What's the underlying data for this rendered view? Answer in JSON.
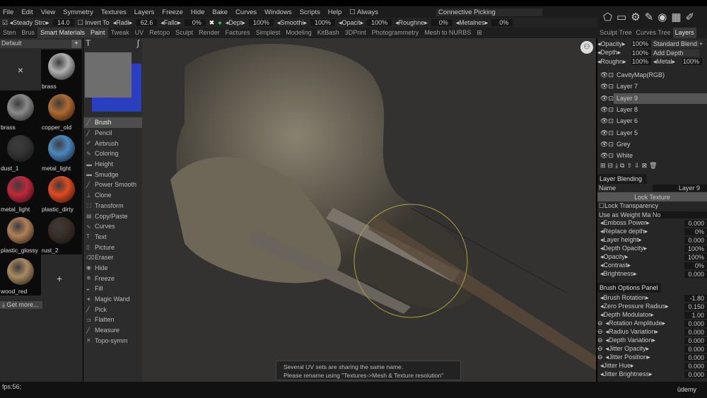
{
  "menu": [
    "File",
    "Edit",
    "View",
    "Symmetry",
    "Textures",
    "Layers",
    "Freeze",
    "Hide",
    "Bake",
    "Curves",
    "Windows",
    "Scripts",
    "Help"
  ],
  "menu_always": "Always",
  "menu_picking": "Connective Picking",
  "toolbar": {
    "steady": "Steady",
    "stro": "Stro",
    "stro_val": "14.0",
    "invert": "Invert",
    "to": "To",
    "radi": "Radi",
    "radi_val": "62.6",
    "fallo": "Fallo",
    "fallo_val": "0%",
    "dept": "Dept",
    "dept_val": "100%",
    "smoothi": "Smoothi",
    "smoothi_val": "100%",
    "opacit": "Opacit",
    "opacit_val": "100%",
    "roughne": "Roughne",
    "roughne_val": "0%",
    "metalnes": "Metalnes",
    "metalnes_val": "0%"
  },
  "left_tabs": [
    "Sten",
    "Brus",
    "Smart Materials"
  ],
  "room_tabs": [
    "Paint",
    "Tweak",
    "UV",
    "Retopo",
    "Sculpt",
    "Render",
    "Factures",
    "Simplest",
    "Modeling",
    "KitBash",
    "3DPrint",
    "Photogrammetry",
    "Mesh to NURBS"
  ],
  "right_tabs": [
    "Sculpt Tree",
    "Curves Tree",
    "Layers"
  ],
  "materials": {
    "preset": "Default",
    "items": [
      {
        "name": "brass",
        "color": "#b0b0b0"
      },
      {
        "name": "brass",
        "color": "#8a8a8a"
      },
      {
        "name": "copper_old",
        "color": "#b06a30"
      },
      {
        "name": "dust_1",
        "color": "#333"
      },
      {
        "name": "metal_light",
        "color": "#4a88c0"
      },
      {
        "name": "metal_light",
        "color": "#c0283a"
      },
      {
        "name": "plastic_dirty",
        "color": "#e04a20"
      },
      {
        "name": "plastic_glossy",
        "color": "#b08058"
      },
      {
        "name": "rust_2",
        "color": "#3a2e26"
      },
      {
        "name": "wood_red",
        "color": "#a88a60"
      }
    ],
    "get_more": "Get more..."
  },
  "tools": [
    "Brush",
    "Pencil",
    "Airbrush",
    "Coloring",
    "Height",
    "Smudge",
    "Power Smooth",
    "Clone",
    "Transform",
    "Copy/Paste",
    "Curves",
    "Text",
    "Picture",
    "Eraser",
    "Hide",
    "Freeze",
    "Fill",
    "Magic Wand",
    "Pick",
    "Flatten",
    "Measure",
    "Topo-symm"
  ],
  "colors": {
    "primary": "#6e6e6e",
    "secondary": "#2a3fbf"
  },
  "layers_top": {
    "opacity": "Opacity",
    "opacity_val": "100%",
    "blend": "Standard Blend",
    "depth": "Depth",
    "depth_val": "100%",
    "depth_mode": "Add Depth",
    "rough": "Roughn",
    "rough_val": "100%",
    "metal": "Metal",
    "metal_val": "100%"
  },
  "layers": [
    "CavityMap(RGB)",
    "Layer 7",
    "Layer 9",
    "Layer 8",
    "Layer 6",
    "Layer 5",
    "Grey",
    "White"
  ],
  "blending": {
    "title": "Layer Blending",
    "name_label": "Name",
    "name_val": "Layer 9",
    "lock_texture": "Lock Texture",
    "lock_transparency": "Lock Transparency",
    "weight_label": "Use as Weight Ma",
    "weight_val": "No",
    "params": [
      {
        "n": "Emboss Power",
        "v": "0.000"
      },
      {
        "n": "Replace depth",
        "v": "0%"
      },
      {
        "n": "Layer height",
        "v": "0.000"
      },
      {
        "n": "Depth Opacity",
        "v": "100%"
      },
      {
        "n": "Opacity",
        "v": "100%"
      },
      {
        "n": "Contrast",
        "v": "0%"
      },
      {
        "n": "Brightness",
        "v": "0.000"
      }
    ]
  },
  "brush_options": {
    "title": "Brush Options Panel",
    "params": [
      {
        "n": "Brush Rotation",
        "v": "-1.80"
      },
      {
        "n": "Zero Pressure Radius",
        "v": "0.150"
      },
      {
        "n": "Depth Modulator",
        "v": "1.00"
      },
      {
        "n": "Rotation Amplitude",
        "v": "0.000"
      },
      {
        "n": "Radius Variation",
        "v": "0.000"
      },
      {
        "n": "Depth Variation",
        "v": "0.000"
      },
      {
        "n": "Jitter Opacity",
        "v": "0.000"
      },
      {
        "n": "Jitter Position",
        "v": "0.000"
      },
      {
        "n": "Jitter Hue",
        "v": "0.000"
      },
      {
        "n": "Jitter Brightness",
        "v": "0.000"
      }
    ]
  },
  "message": [
    "Several UV sets are sharing the same name.",
    "Please rename using \"Textures->Mesh & Texture resolution\""
  ],
  "fps": "fps:56;",
  "watermark": "ūdemy"
}
